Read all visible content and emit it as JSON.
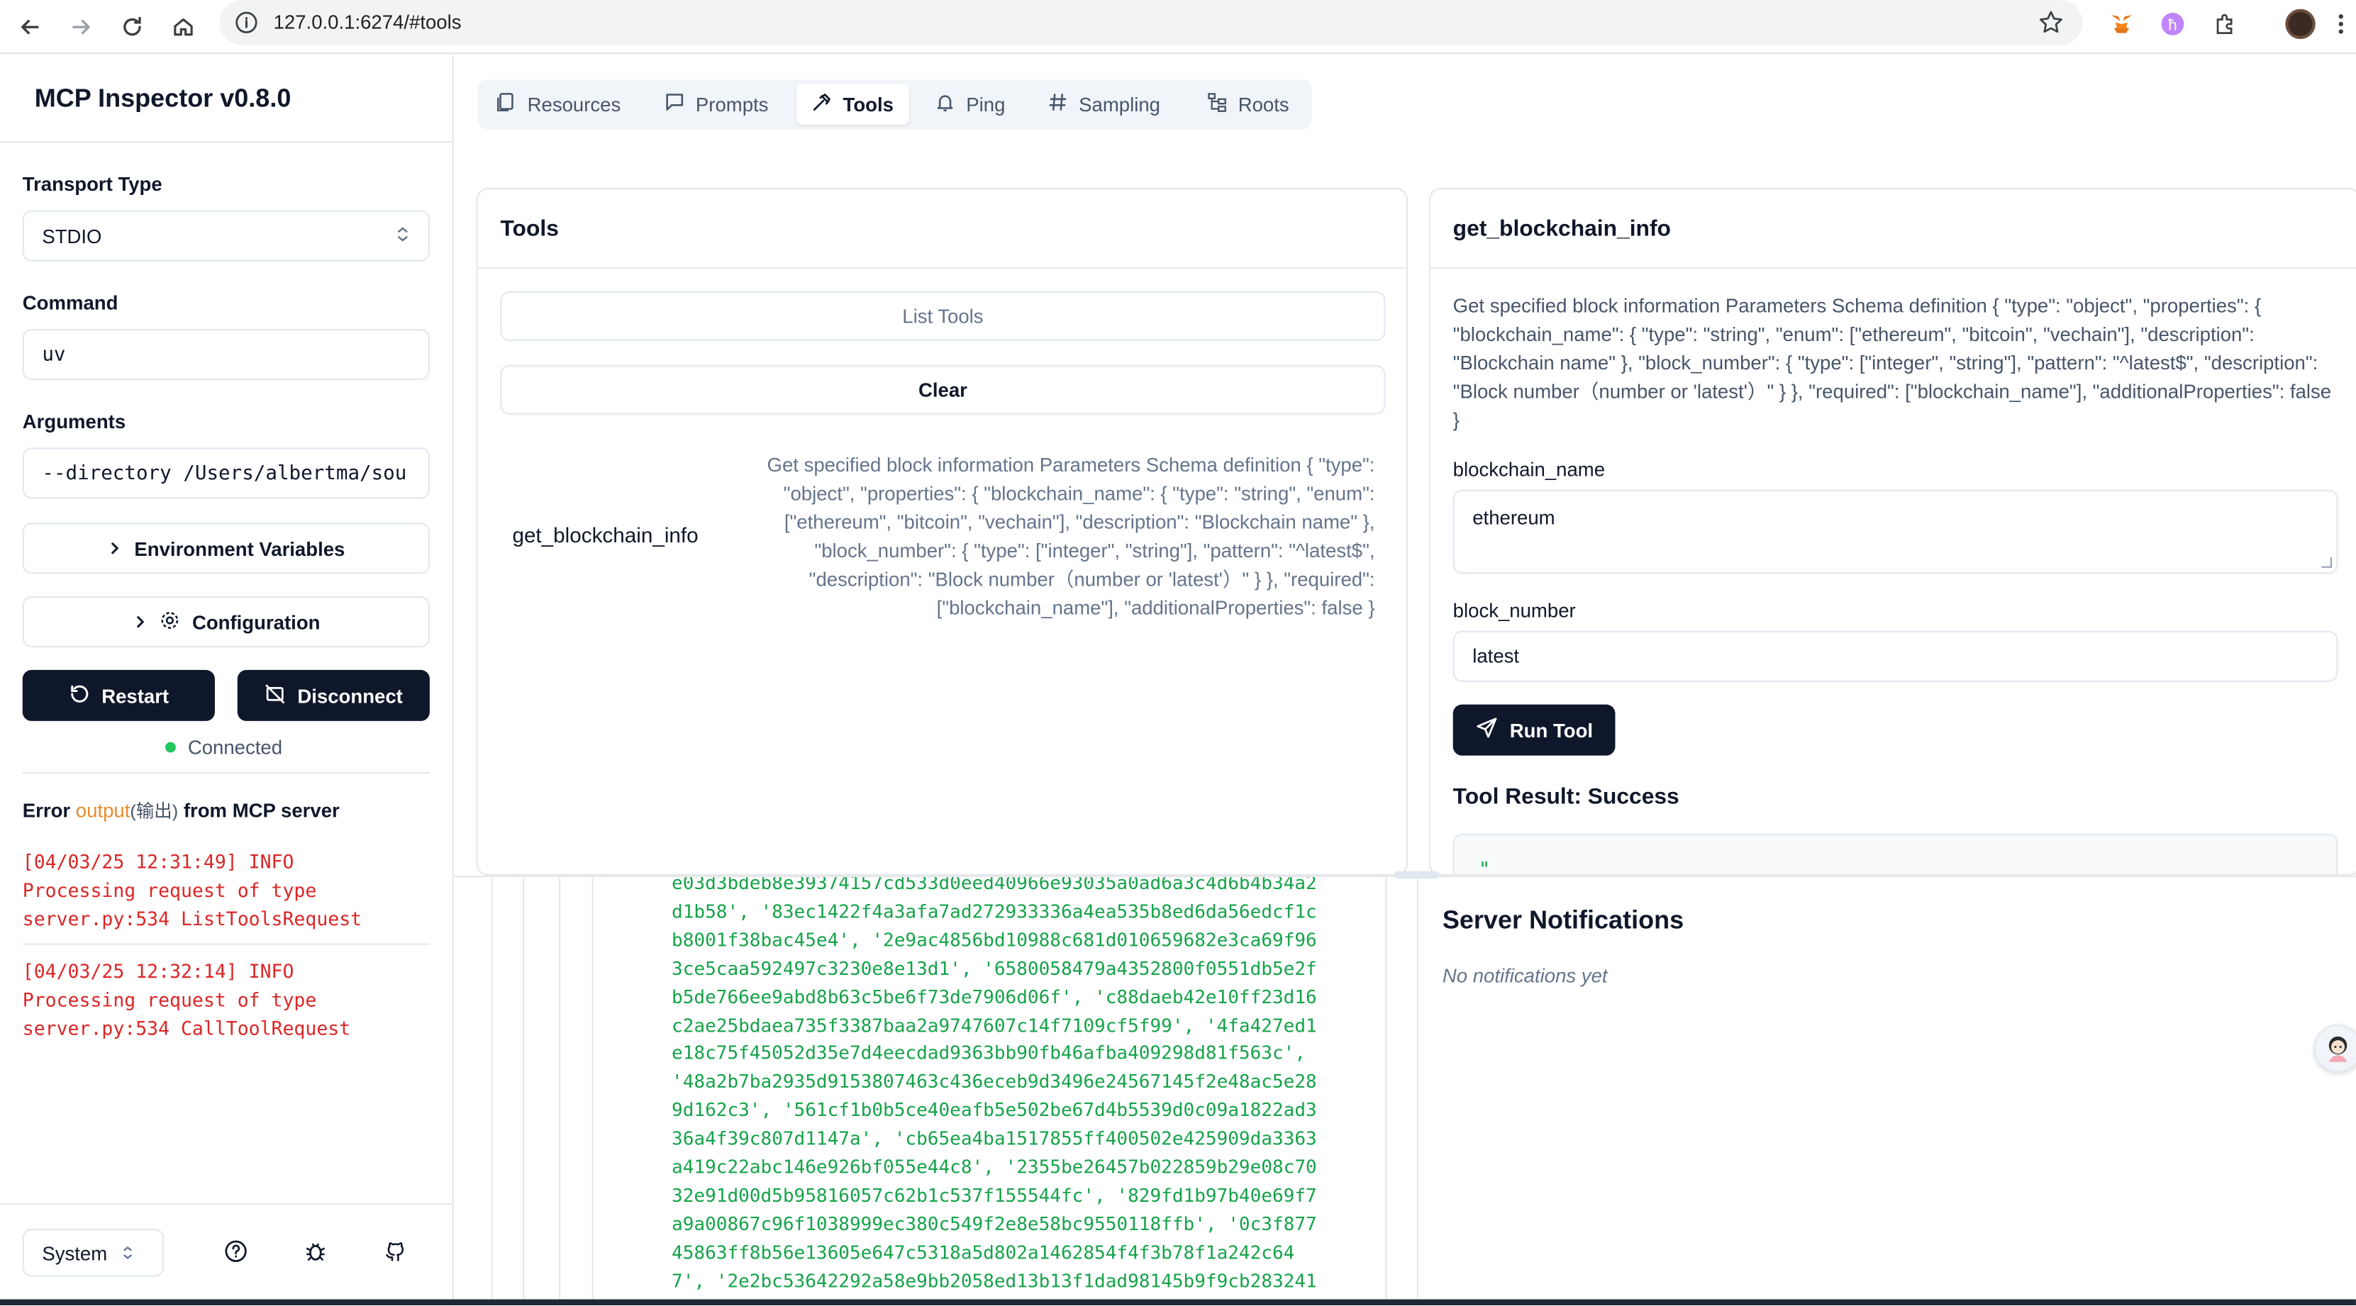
{
  "browser": {
    "url": "127.0.0.1:6274/#tools"
  },
  "sidebar": {
    "title": "MCP Inspector v0.8.0",
    "transport_label": "Transport Type",
    "transport_value": "STDIO",
    "command_label": "Command",
    "command_value": "uv",
    "arguments_label": "Arguments",
    "arguments_value": "--directory /Users/albertma/sou",
    "env_button": "Environment Variables",
    "config_button": "Configuration",
    "restart_button": "Restart",
    "disconnect_button": "Disconnect",
    "status_text": "Connected",
    "error_prefix": "Error ",
    "error_output": "output",
    "error_cjk": "(输出)",
    "error_suffix": " from MCP server",
    "logs": [
      "[04/03/25 12:31:49] INFO\nProcessing request of type\nserver.py:534 ListToolsRequest",
      "[04/03/25 12:32:14] INFO\nProcessing request of type\nserver.py:534 CallToolRequest"
    ],
    "theme_value": "System"
  },
  "tabs": [
    {
      "label": "Resources",
      "icon": "files-icon"
    },
    {
      "label": "Prompts",
      "icon": "message-icon"
    },
    {
      "label": "Tools",
      "icon": "hammer-icon"
    },
    {
      "label": "Ping",
      "icon": "bell-icon"
    },
    {
      "label": "Sampling",
      "icon": "hash-icon"
    },
    {
      "label": "Roots",
      "icon": "folder-tree-icon"
    }
  ],
  "tools_panel": {
    "title": "Tools",
    "list_button": "List Tools",
    "clear_button": "Clear",
    "tool_name": "get_blockchain_info",
    "tool_description": "Get specified block information Parameters Schema definition { \"type\": \"object\", \"properties\": { \"blockchain_name\": { \"type\": \"string\", \"enum\": [\"ethereum\", \"bitcoin\", \"vechain\"], \"description\": \"Blockchain name\" }, \"block_number\": { \"type\": [\"integer\", \"string\"], \"pattern\": \"^latest$\", \"description\": \"Block number（number or 'latest'）\" } }, \"required\": [\"blockchain_name\"], \"additionalProperties\": false }"
  },
  "detail_panel": {
    "title": "get_blockchain_info",
    "description": "Get specified block information Parameters Schema definition { \"type\": \"object\", \"properties\": { \"blockchain_name\": { \"type\": \"string\", \"enum\": [\"ethereum\", \"bitcoin\", \"vechain\"], \"description\": \"Blockchain name\" }, \"block_number\": { \"type\": [\"integer\", \"string\"], \"pattern\": \"^latest$\", \"description\": \"Block number（number or 'latest'）\" } }, \"required\": [\"blockchain_name\"], \"additionalProperties\": false }",
    "param1_label": "blockchain_name",
    "param1_value": "ethereum",
    "param2_label": "block_number",
    "param2_value": "latest",
    "run_button": "Run Tool",
    "result_title": "Tool Result: Success",
    "result_preview": "\""
  },
  "history_output": "e03d3bdeb8e39374157cd533d0eed40966e93035a0ad6a3c4d6b4b34a2\nd1b58', '83ec1422f4a3afa7ad272933336a4ea535b8ed6da56edcf1c\nb8001f38bac45e4', '2e9ac4856bd10988c681d010659682e3ca69f96\n3ce5caa592497c3230e8e13d1', '6580058479a4352800f0551db5e2f\nb5de766ee9abd8b63c5be6f73de7906d06f', 'c88daeb42e10ff23d16\nc2ae25bdaea735f3387baa2a9747607c14f7109cf5f99', '4fa427ed1\ne18c75f45052d35e7d4eecdad9363bb90fb46afba409298d81f563c',\n'48a2b7ba2935d9153807463c436eceb9d3496e24567145f2e48ac5e28\n9d162c3', '561cf1b0b5ce40eafb5e502be67d4b5539d0c09a1822ad3\n36a4f39c807d1147a', 'cb65ea4ba1517855ff400502e425909da3363\na419c22abc146e926bf055e44c8', '2355be26457b022859b29e08c70\n32e91d00d5b95816057c62b1c537f155544fc', '829fd1b97b40e69f7\na9a00867c96f1038999ec380c549f2e8e58bc9550118ffb', '0c3f877\n45863ff8b56e13605e647c5318a5d802a1462854f4f3b78f1a242c64\n7', '2e2bc53642292a58e9bb2058ed13b13f1dad98145b9f9cb283241",
  "notifications": {
    "title": "Server Notifications",
    "empty_text": "No notifications yet"
  },
  "colors": {
    "primary": "#0f172a",
    "success": "#16a34a",
    "error": "#dc2626",
    "connected": "#22c55e",
    "accent_orange": "#ea8a2f"
  }
}
